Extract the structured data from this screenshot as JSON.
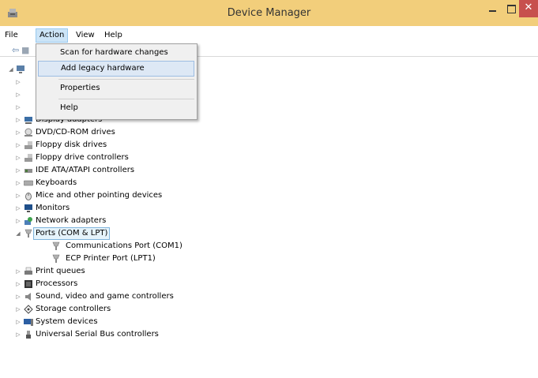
{
  "window": {
    "title": "Device Manager"
  },
  "menubar": {
    "file": "File",
    "action": "Action",
    "view": "View",
    "help": "Help"
  },
  "action_menu": {
    "items": [
      {
        "label": "Scan for hardware changes"
      },
      {
        "label": "Add legacy hardware",
        "highlighted": true
      },
      {
        "label": "Properties"
      },
      {
        "label": "Help"
      }
    ]
  },
  "tree": {
    "categories": [
      "Display adapters",
      "DVD/CD-ROM drives",
      "Floppy disk drives",
      "Floppy drive controllers",
      "IDE ATA/ATAPI controllers",
      "Keyboards",
      "Mice and other pointing devices",
      "Monitors",
      "Network adapters",
      "Ports (COM & LPT)",
      "Print queues",
      "Processors",
      "Sound, video and game controllers",
      "Storage controllers",
      "System devices",
      "Universal Serial Bus controllers"
    ],
    "ports_children": [
      "Communications Port (COM1)",
      "ECP Printer Port (LPT1)"
    ]
  },
  "colors": {
    "titlebar": "#f2ce7b",
    "close_button": "#c7504d",
    "selection": "#e5f3fb",
    "menu_highlight": "#cce4f7"
  }
}
